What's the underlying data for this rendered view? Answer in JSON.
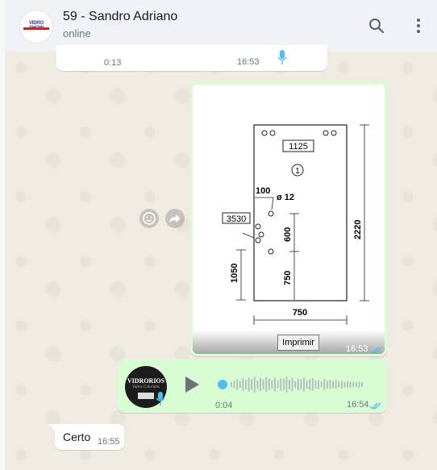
{
  "header": {
    "contact_name": "59 - Sandro Adriano",
    "status": "online",
    "avatar_logo": "VIDRO SHOW",
    "search_icon": "search-icon",
    "menu_icon": "kebab-menu-icon"
  },
  "messages": {
    "previous_audio": {
      "duration": "0:13",
      "time": "16:53"
    },
    "image": {
      "time": "16:53",
      "print_label": "Imprimir",
      "drawing": {
        "width_label": "1125",
        "circle_label": "1",
        "offset_label": "100",
        "hole_label": "ø 12",
        "side_label": "3530",
        "dim_600": "600",
        "dim_2220": "2220",
        "dim_1050": "1050",
        "dim_750_v": "750",
        "dim_750_h": "750"
      }
    },
    "audio": {
      "duration": "0:04",
      "time": "16:54",
      "avatar_brand": "VIDRORIOS",
      "avatar_sub": "Vidros Coloridos"
    },
    "text": {
      "body": "Certo",
      "time": "16:55"
    }
  },
  "colors": {
    "incoming": "#ffffff",
    "outgoing": "#d9fdd3",
    "wallpaper": "#efeae2",
    "tick_read": "#53bdeb",
    "mic_accent": "#53bdeb"
  }
}
